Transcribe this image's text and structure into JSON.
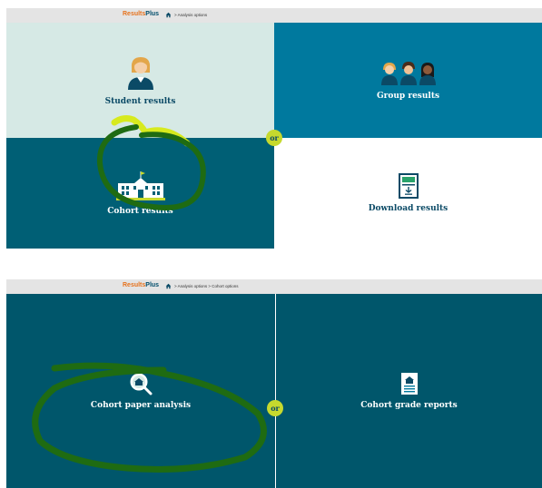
{
  "colors": {
    "mint": "#d6e9e5",
    "blue": "#00799e",
    "teal": "#005f75",
    "dark_teal": "#00566b",
    "badge": "#c6d92e",
    "brand_orange": "#e6721d",
    "brand_blue": "#004d6b",
    "annotation": "#1f6b12"
  },
  "top_screen": {
    "logo": {
      "part1": "Results",
      "part2": "Plus"
    },
    "breadcrumb": "> Analysis options",
    "tiles": {
      "student": {
        "label": "Student results",
        "icon": "student-icon"
      },
      "group": {
        "label": "Group results",
        "icon": "group-icon"
      },
      "cohort": {
        "label": "Cohort results",
        "icon": "school-building-icon"
      },
      "download": {
        "label": "Download results",
        "icon": "download-document-icon"
      }
    },
    "or_label": "or"
  },
  "bottom_screen": {
    "logo": {
      "part1": "Results",
      "part2": "Plus"
    },
    "breadcrumb": "> Analysis options > Cohort options",
    "tiles": {
      "paper": {
        "label": "Cohort paper analysis",
        "icon": "magnifier-school-icon"
      },
      "grade": {
        "label": "Cohort grade reports",
        "icon": "report-document-icon"
      }
    },
    "or_label": "or"
  }
}
